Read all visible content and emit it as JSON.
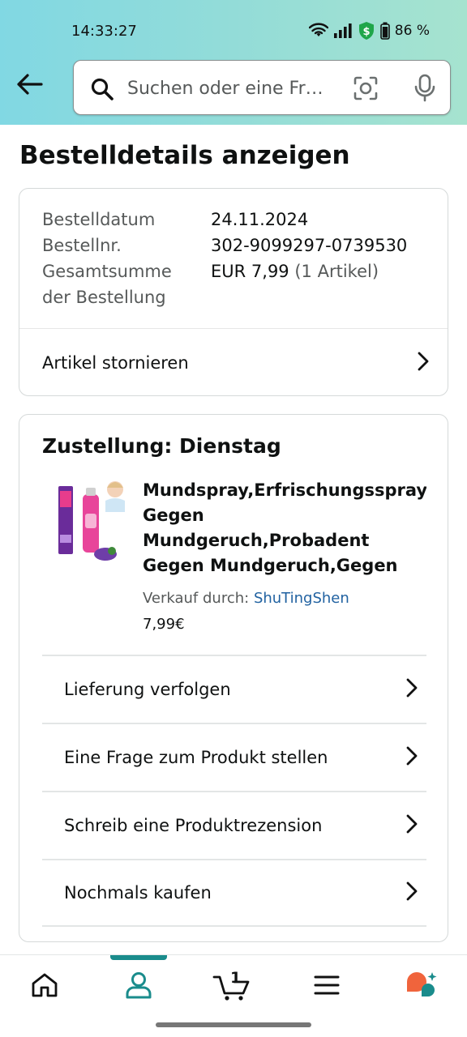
{
  "status_bar": {
    "time": "14:33:27",
    "battery": "86 %",
    "icons": [
      "wifi-icon",
      "signal-icon",
      "shield-dollar-icon",
      "battery-icon"
    ]
  },
  "header": {
    "back_icon": "arrow-left-icon",
    "search": {
      "placeholder": "Suchen oder eine Fr…",
      "icons": [
        "search-icon",
        "camera-lens-icon",
        "microphone-icon"
      ]
    }
  },
  "page": {
    "title": "Bestelldetails anzeigen"
  },
  "order_summary": {
    "rows": [
      {
        "label": "Bestelldatum",
        "value": "24.11.2024"
      },
      {
        "label": "Bestellnr.",
        "value": "302-9099297-0739530"
      },
      {
        "label": "Gesamtsumme der Bestellung",
        "label_line1": "Gesamtsumme",
        "label_line2": "der Bestellung",
        "value": "EUR 7,99",
        "value_suffix": "(1 Artikel)"
      }
    ],
    "cancel_label": "Artikel stornieren"
  },
  "delivery": {
    "title": "Zustellung: Dienstag",
    "product": {
      "title": "Mundspray,Erfrischungsspray,M\nGegen Mundgeruch,Probadent\nGegen Mundgeruch,Gegen\nMundgeruch Und Karies,Tra...",
      "seller_prefix": "Verkauf durch:",
      "seller_name": "ShuTingShen",
      "price": "7,99€"
    },
    "actions": [
      {
        "label": "Lieferung verfolgen"
      },
      {
        "label": "Eine Frage zum Produkt stellen"
      },
      {
        "label": "Schreib eine Produktrezension"
      },
      {
        "label": "Nochmals kaufen"
      }
    ]
  },
  "bottom_nav": {
    "items": [
      "home-icon",
      "account-icon",
      "cart-icon",
      "menu-icon",
      "rufus-icon"
    ],
    "active": "account-icon",
    "cart_count": "1"
  },
  "colors": {
    "header_gradient_start": "#81d8e3",
    "header_gradient_end": "#a6e3cf",
    "link": "#2162a1",
    "active_nav": "#1a8c8c",
    "rufus_orange": "#f0643c",
    "rufus_teal": "#1a8c8c"
  }
}
